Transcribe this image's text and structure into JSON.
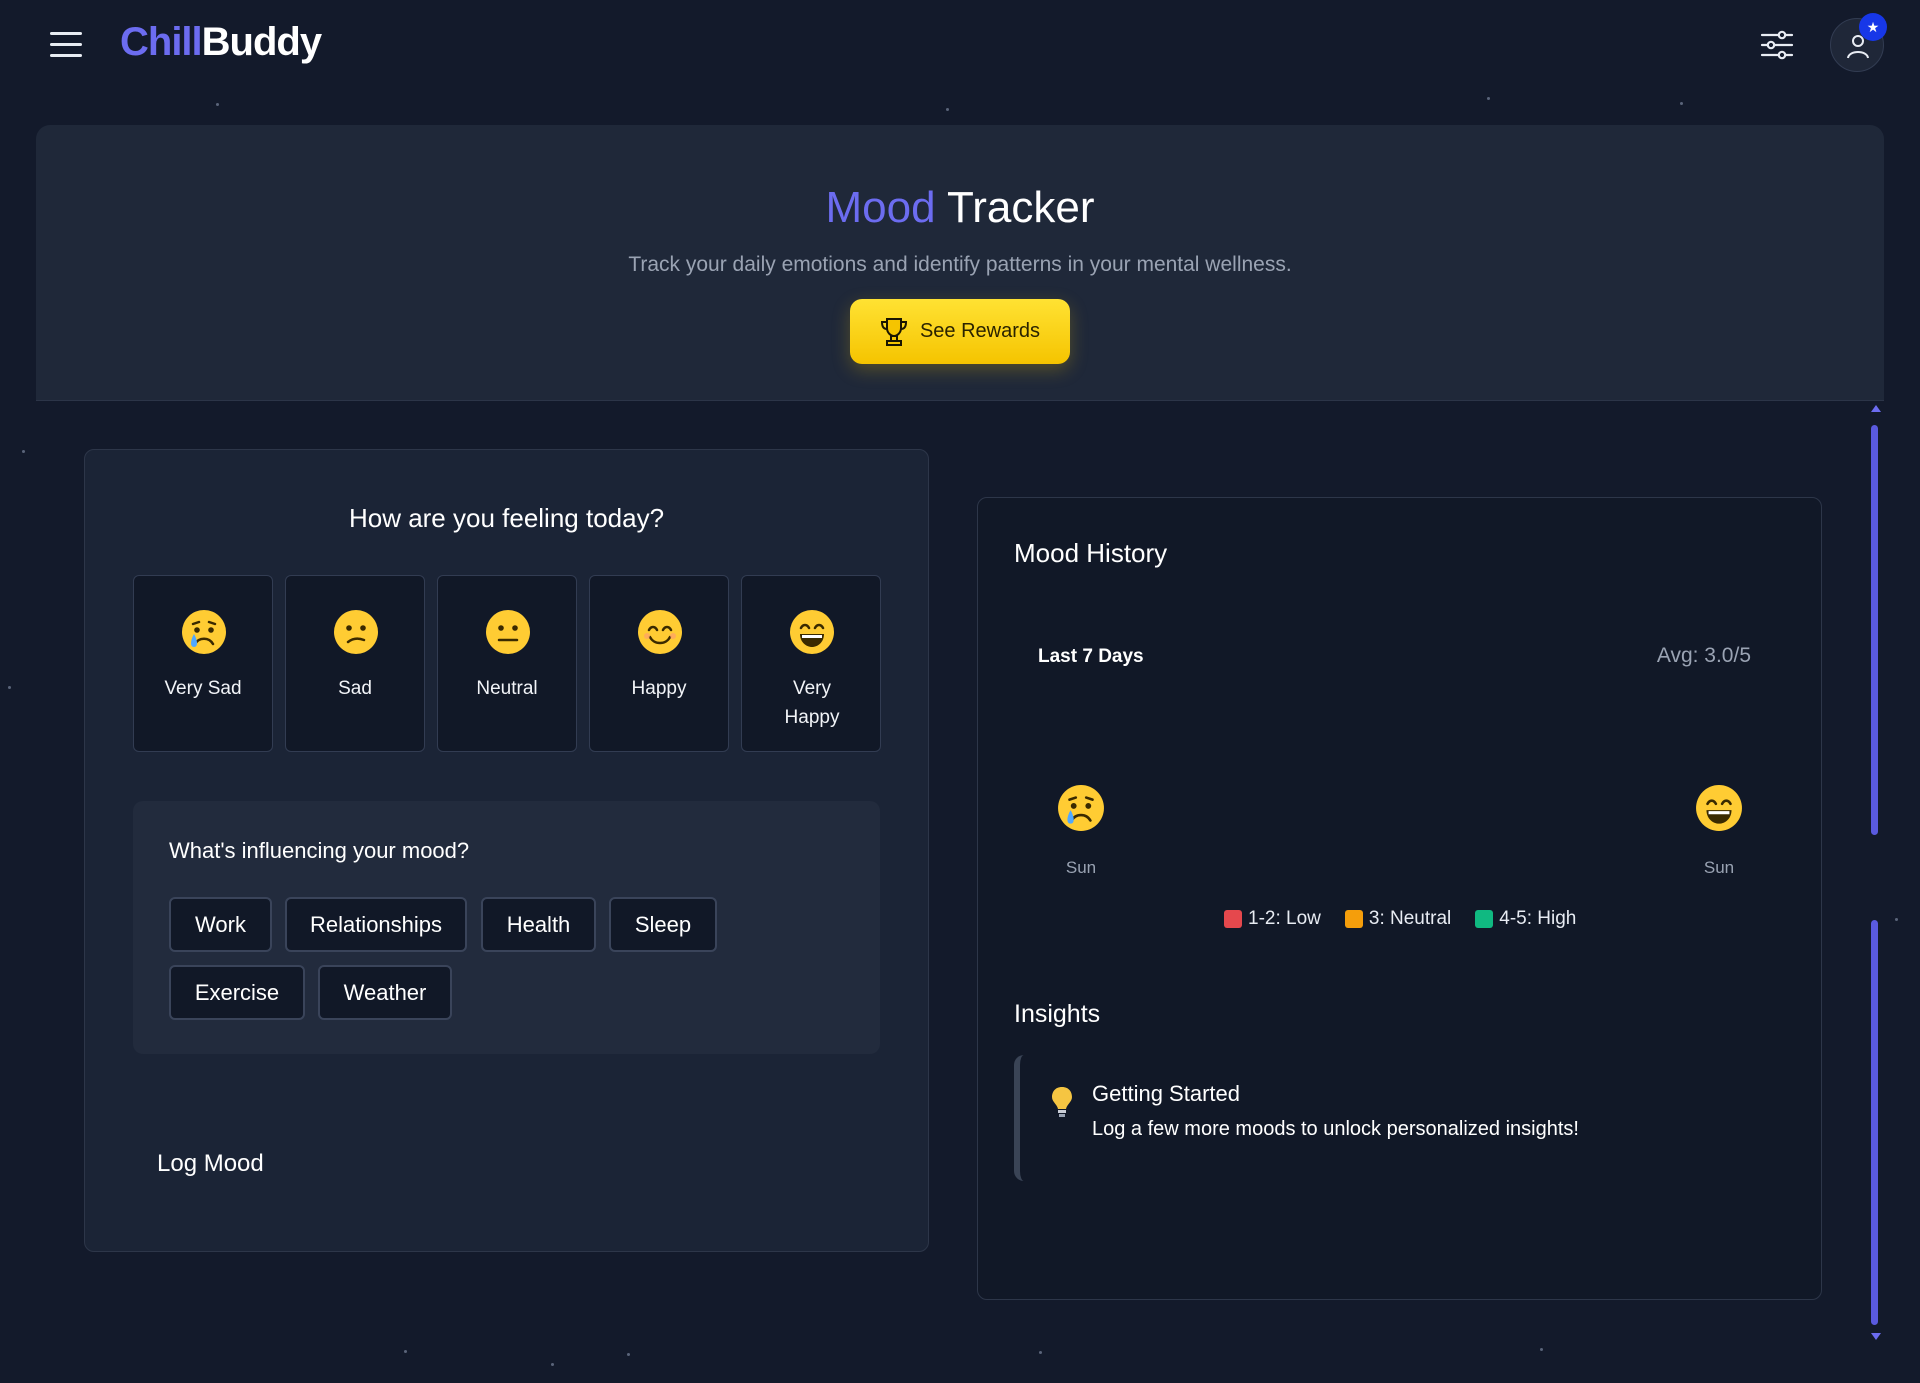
{
  "brand": {
    "logo_part1": "Chill",
    "logo_part2": "Buddy"
  },
  "header": {
    "menu_icon": "hamburger-icon",
    "filter_icon": "sliders-icon",
    "profile_icon": "user-icon",
    "badge_icon": "star-icon"
  },
  "hero": {
    "title_accent": "Mood",
    "title_rest": "Tracker",
    "subtitle": "Track your daily emotions and identify patterns in your mental wellness.",
    "rewards_label": "See Rewards",
    "rewards_icon": "trophy-icon"
  },
  "mood_entry": {
    "question": "How are you feeling today?",
    "options": [
      {
        "label": "Very Sad",
        "icon": "crying-face-icon"
      },
      {
        "label": "Sad",
        "icon": "confused-face-icon"
      },
      {
        "label": "Neutral",
        "icon": "neutral-face-icon"
      },
      {
        "label": "Happy",
        "icon": "smiling-face-icon"
      },
      {
        "label": "Very Happy",
        "icon": "grinning-face-icon"
      }
    ],
    "factors_title": "What's influencing your mood?",
    "factors": [
      "Work",
      "Relationships",
      "Health",
      "Sleep",
      "Exercise",
      "Weather"
    ],
    "log_label": "Log Mood"
  },
  "history": {
    "title": "Mood History",
    "range_label": "Last 7 Days",
    "average": "Avg: 3.0/5",
    "entries": [
      {
        "day": "Sun",
        "icon": "crying-face-icon"
      },
      {
        "day": "Sun",
        "icon": "grinning-face-icon"
      }
    ],
    "legend": [
      {
        "label": "1-2: Low",
        "color": "#e5484d"
      },
      {
        "label": "3: Neutral",
        "color": "#f59e0b"
      },
      {
        "label": "4-5: High",
        "color": "#10b981"
      }
    ]
  },
  "insights": {
    "title": "Insights",
    "items": [
      {
        "title": "Getting Started",
        "text": "Log a few more moods to unlock personalized insights!",
        "icon": "lightbulb-icon"
      }
    ]
  },
  "colors": {
    "accent": "#6c6cf0",
    "reward": "#ffd400",
    "background": "#131a2b"
  }
}
